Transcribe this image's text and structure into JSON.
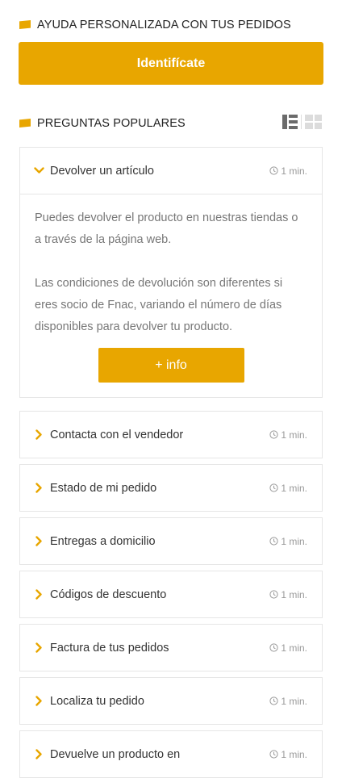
{
  "help_section": {
    "title": "AYUDA PERSONALIZADA CON TUS PEDIDOS",
    "identify_button": "Identifícate"
  },
  "faq_section": {
    "title": "PREGUNTAS POPULARES",
    "view_options": [
      "list-view-icon",
      "grid-view-icon"
    ],
    "expanded": {
      "question": "Devolver un artículo",
      "time": "1 min.",
      "answer_1": "Puedes devolver el producto en nuestras tiendas o a través de la página web.",
      "answer_2": "Las condiciones de devolución son diferentes si eres socio de Fnac, variando el número de días disponibles para devolver tu producto.",
      "info_button": "+ info"
    },
    "items": [
      {
        "question": "Contacta con el vendedor",
        "time": "1 min."
      },
      {
        "question": "Estado de mi pedido",
        "time": "1 min."
      },
      {
        "question": "Entregas a domicilio",
        "time": "1 min."
      },
      {
        "question": "Códigos de descuento",
        "time": "1 min."
      },
      {
        "question": "Factura de tus pedidos",
        "time": "1 min."
      },
      {
        "question": "Localiza tu pedido",
        "time": "1 min."
      },
      {
        "question": "Devuelve un producto en",
        "time": "1 min."
      }
    ]
  },
  "colors": {
    "accent": "#e8a600",
    "border": "#e6e6e6",
    "muted_text": "#777777"
  }
}
